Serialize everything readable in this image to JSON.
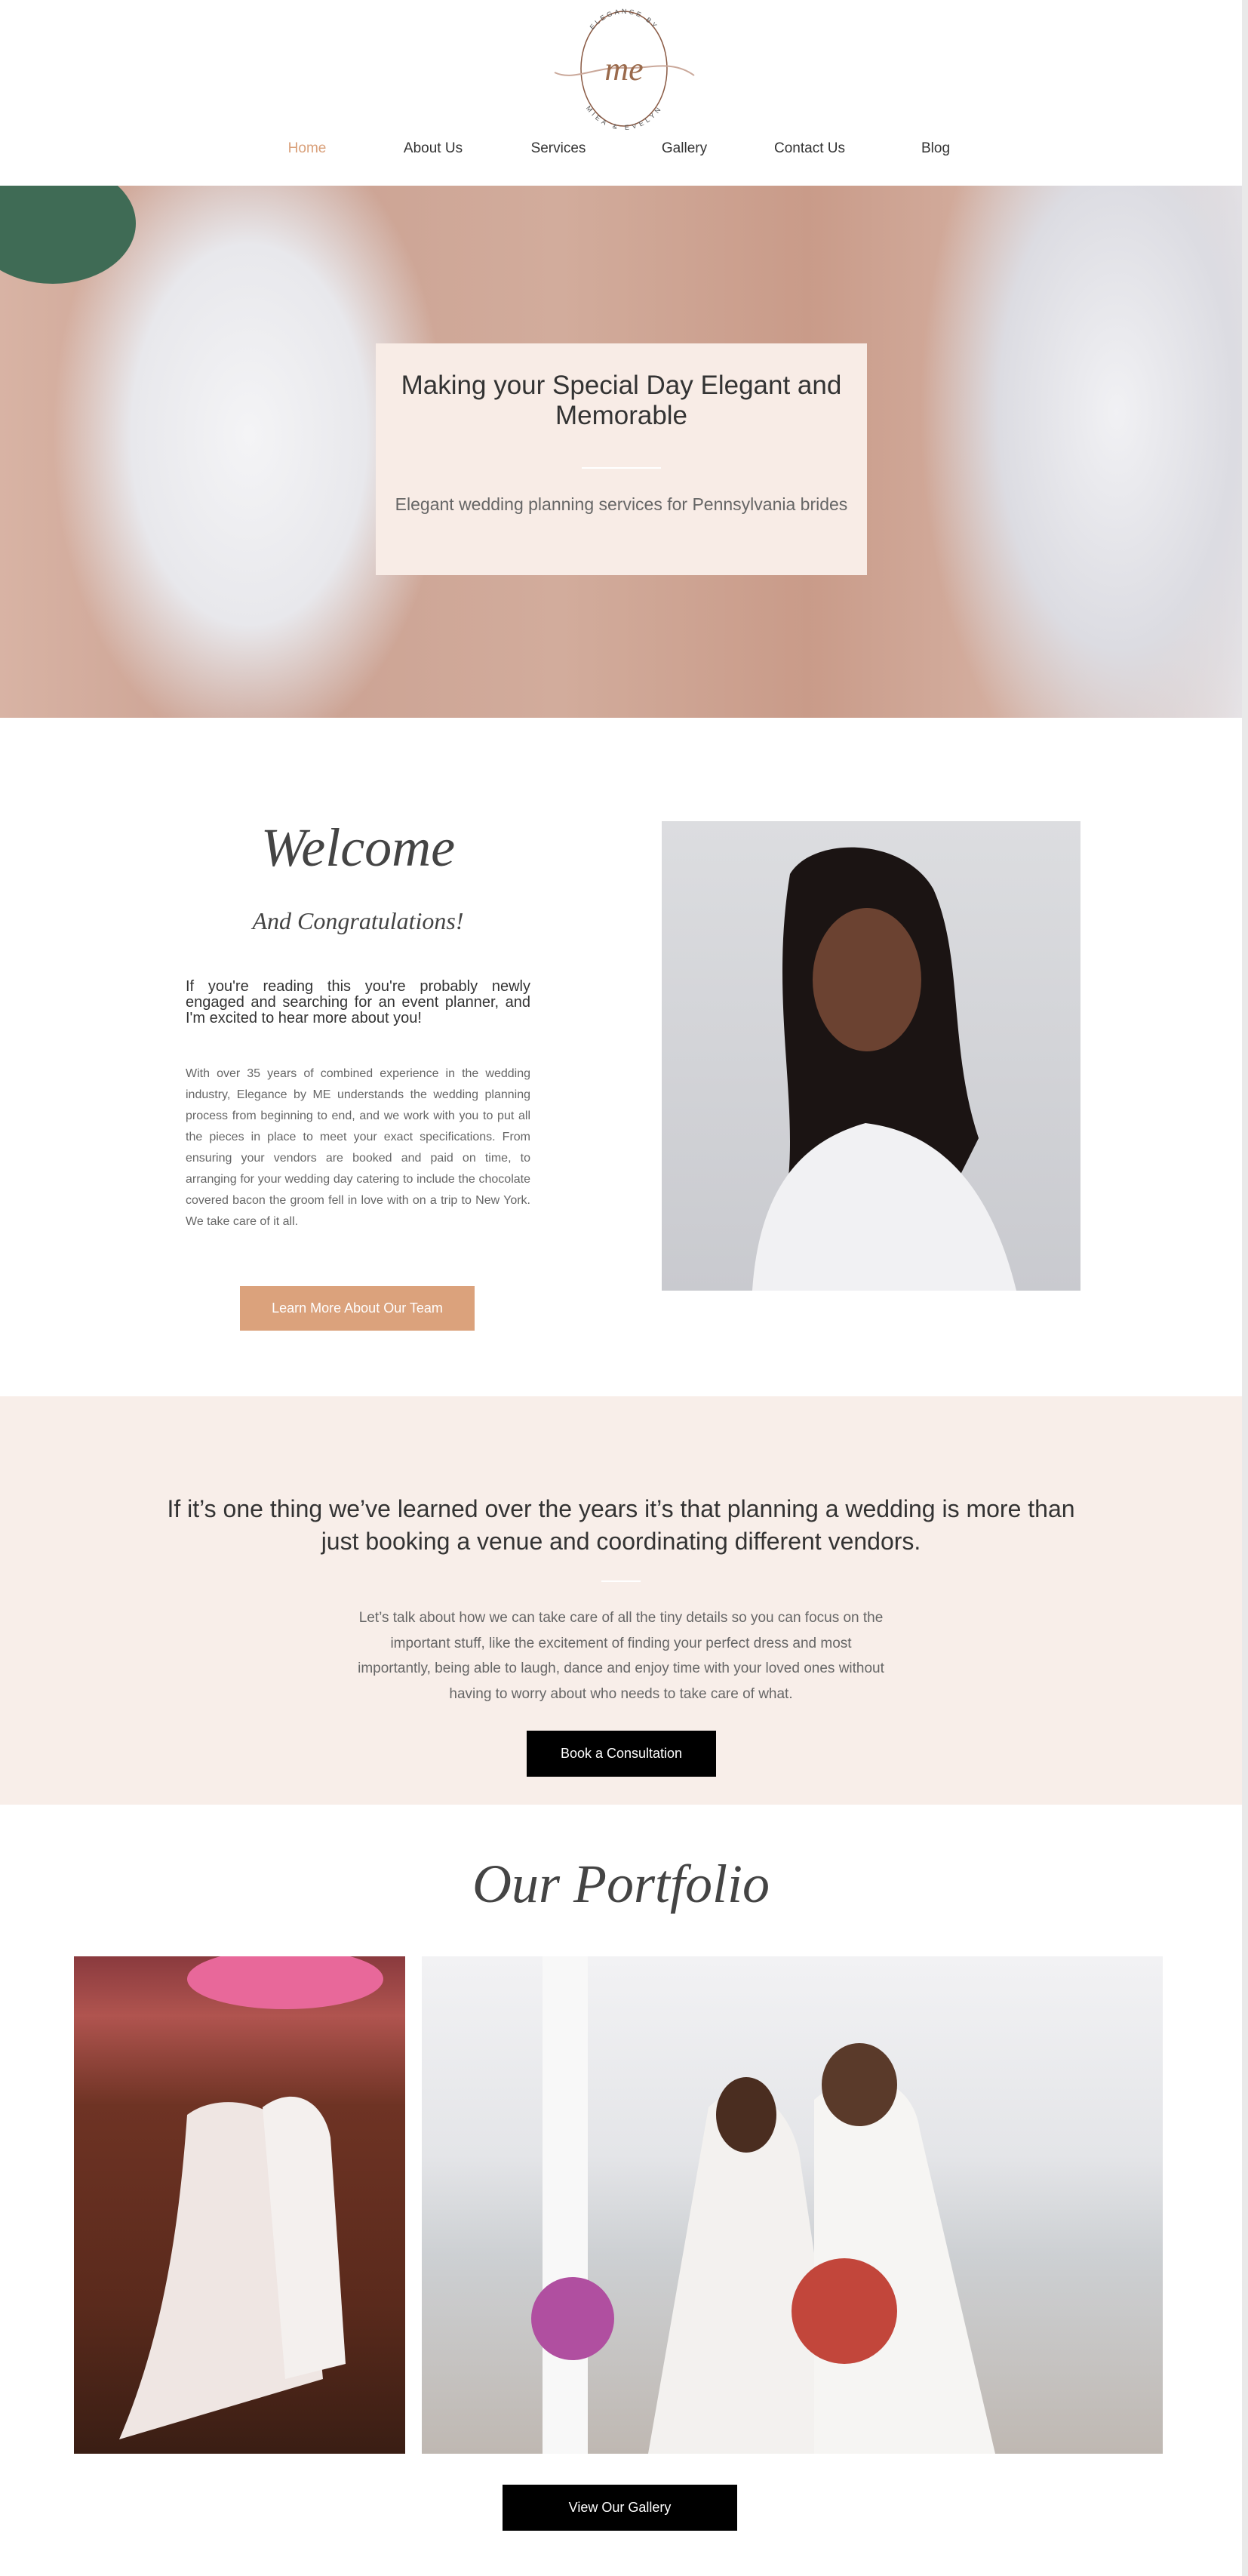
{
  "logo": {
    "top_text": "ELEGANCE BY",
    "monogram": "me",
    "bottom_text": "MIEA & EVELYN"
  },
  "nav": {
    "items": [
      {
        "label": "Home",
        "active": true
      },
      {
        "label": "About Us"
      },
      {
        "label": "Services"
      },
      {
        "label": "Gallery"
      },
      {
        "label": "Contact Us"
      },
      {
        "label": "Blog"
      }
    ]
  },
  "hero": {
    "title": "Making your Special Day Elegant and Memorable",
    "subtitle": "Elegant wedding planning services for Pennsylvania brides"
  },
  "welcome": {
    "title": "Welcome",
    "subtitle": "And Congratulations!",
    "lead": "If you're reading this you're probably newly engaged and searching for an event planner, and I'm excited to hear more about you!",
    "body": "With over 35 years of combined experience in the wedding industry, Elegance by ME understands the wedding planning process from beginning to end, and we work with you to put all the pieces in place to meet your exact specifications. From ensuring your vendors are booked and paid on time, to arranging for your wedding day catering to include the chocolate covered bacon the groom fell in love with on a trip to New York. We take care of it all.",
    "button": "Learn More About Our Team"
  },
  "about": {
    "heading": "If it’s one thing we’ve learned over the years it’s that planning a wedding is more than just booking a venue and coordinating different vendors.",
    "body": "Let’s talk about how we can take care of all the tiny details so you can focus on the important stuff, like the excitement of finding your perfect dress and most importantly, being able to laugh, dance and enjoy time with your loved ones without having to worry about who needs to take care of what.",
    "button": "Book a Consultation"
  },
  "portfolio": {
    "title": "Our Portfolio",
    "button": "View Our Gallery"
  },
  "colors": {
    "accent": "#d9a07a",
    "button_tan": "#dba27c",
    "section_bg": "#f8eee9",
    "button_dark": "#000000"
  }
}
